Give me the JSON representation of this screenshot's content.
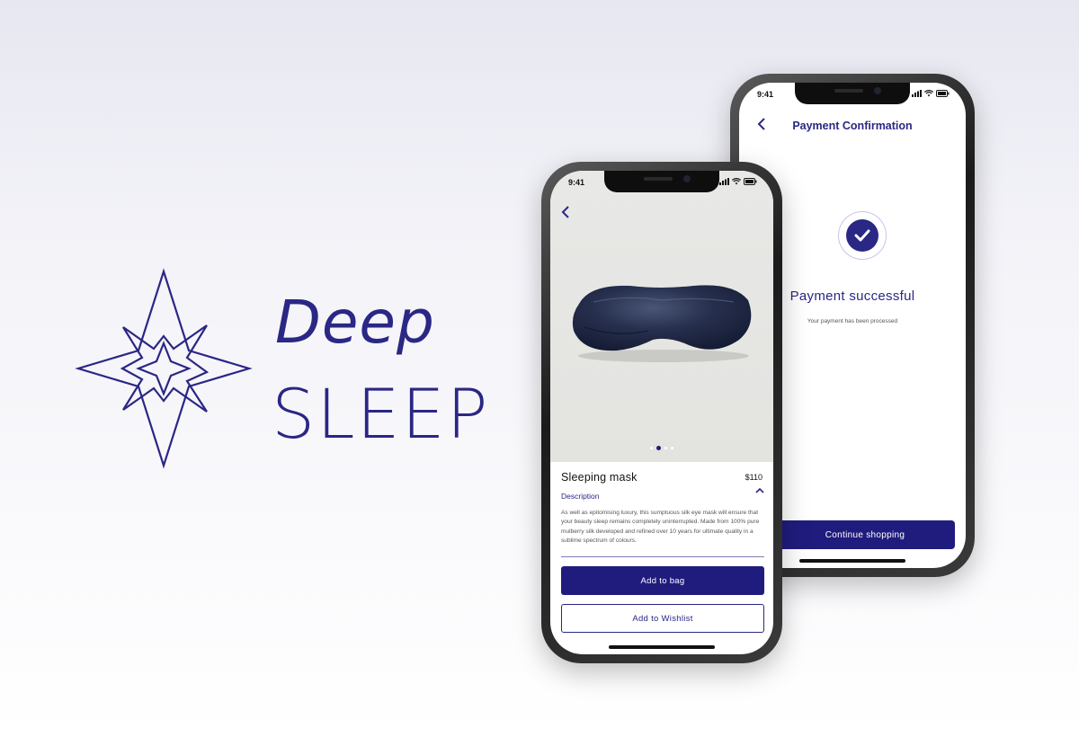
{
  "brand": {
    "name_line1": "Deep",
    "name_line2": "SLEEP",
    "logo_icon": "compass-star-icon",
    "color": "#2a2785"
  },
  "payment_screen": {
    "status_time": "9:41",
    "back_icon": "chevron-left-icon",
    "title": "Payment Confirmation",
    "success_icon": "check-circle-icon",
    "message": "Payment successful",
    "sub_message": "Your payment has been processed",
    "continue_label": "Continue shopping"
  },
  "product_screen": {
    "status_time": "9:41",
    "back_icon": "chevron-left-icon",
    "carousel": {
      "count": 4,
      "active_index": 1
    },
    "product_name": "Sleeping mask",
    "price": "$110",
    "description_label": "Description",
    "description_text": "As well as epitomising luxury, this sumptuous silk eye mask will ensure that your beauty sleep remains completely uninterrupted. Made from 100% pure mulberry silk developed and refined over 10 years for ultimate quality in a sublime spectrum of colours.",
    "add_to_bag_label": "Add to bag",
    "add_to_wishlist_label": "Add to Wishlist"
  },
  "colors": {
    "primary": "#201c7e",
    "accent": "#2a2785"
  }
}
